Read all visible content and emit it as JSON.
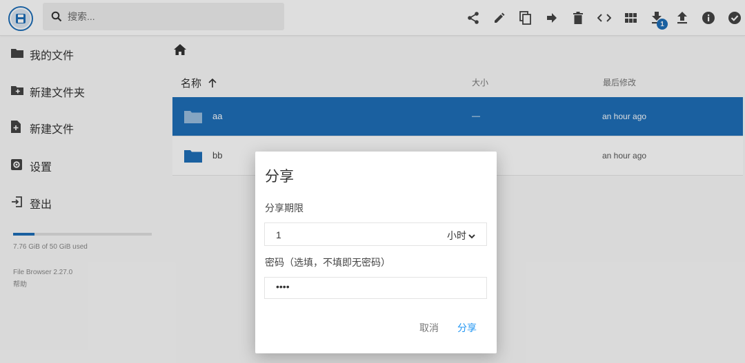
{
  "search": {
    "placeholder": "搜索..."
  },
  "toolbar": {
    "icons": [
      "share-icon",
      "edit-icon",
      "copy-icon",
      "move-icon",
      "delete-icon",
      "code-icon",
      "grid-view-icon",
      "download-icon",
      "upload-icon",
      "info-icon",
      "select-icon"
    ],
    "download_badge": "1"
  },
  "sidebar": {
    "items": [
      {
        "label": "我的文件",
        "icon": "folder-icon"
      },
      {
        "label": "新建文件夹",
        "icon": "new-folder-icon"
      },
      {
        "label": "新建文件",
        "icon": "new-file-icon"
      },
      {
        "label": "设置",
        "icon": "settings-icon"
      },
      {
        "label": "登出",
        "icon": "logout-icon"
      }
    ],
    "usage": "7.76 GiB of 50 GiB used",
    "usage_fraction": 0.155,
    "version": "File Browser 2.27.0",
    "help": "帮助"
  },
  "listing": {
    "columns": {
      "name": "名称",
      "size": "大小",
      "modified": "最后修改"
    },
    "rows": [
      {
        "name": "aa",
        "size": "—",
        "modified": "an hour ago",
        "selected": true
      },
      {
        "name": "bb",
        "size": "",
        "modified": "an hour ago",
        "selected": false
      }
    ]
  },
  "dialog": {
    "title": "分享",
    "expire_label": "分享期限",
    "expire_value": "1",
    "expire_unit": "小时",
    "password_label": "密码（选填，不填即无密码）",
    "password_value": "••••",
    "cancel": "取消",
    "share": "分享"
  },
  "colors": {
    "accent": "#1e6fb8",
    "link": "#2196f3"
  }
}
